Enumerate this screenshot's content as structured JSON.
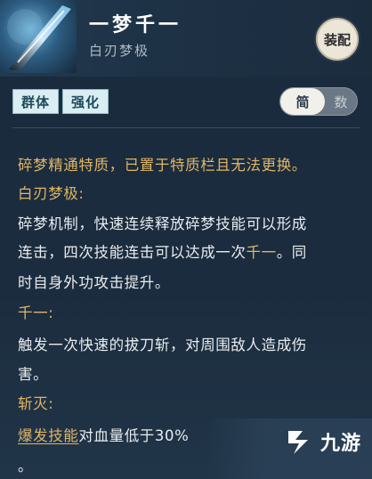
{
  "skill": {
    "name": "一梦千一",
    "subtitle": "白刃梦极",
    "equip_label": "装配"
  },
  "tags": [
    "群体",
    "强化"
  ],
  "toggle": {
    "active": "简",
    "inactive": "数"
  },
  "description": {
    "line1": "碎梦精通特质，已置于特质栏且无法更换。",
    "section1_title": "白刃梦极:",
    "line2": "碎梦机制，快速连续释放碎梦技能可以形成",
    "line3_a": "连击，四次技能连击可以达成一次",
    "line3_hl": "千一",
    "line3_b": "。同",
    "line4": "时自身外功攻击提升。",
    "section2_title": "千一:",
    "line5": "触发一次快速的拔刀斩，对周围敌人造成伤",
    "line6": "害。",
    "section3_title": "斩灭:",
    "line7_hl": "爆发技能",
    "line7_b": "对血量低于30%",
    "line8": "。"
  },
  "watermark": {
    "text": "九游"
  },
  "colors": {
    "accent_gold": "#e0b566",
    "tag_bg": "#d9eef2",
    "panel_bg": "#1b2c3e"
  }
}
